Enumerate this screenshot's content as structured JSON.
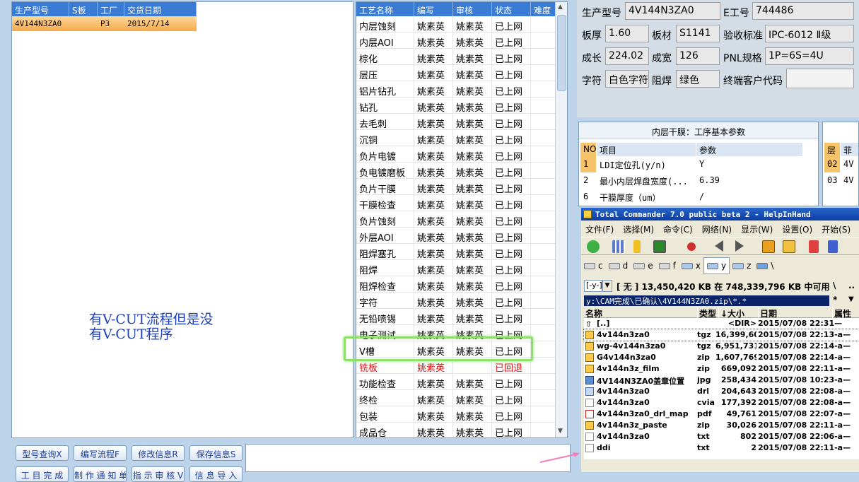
{
  "order_grid": {
    "headers": [
      "生产型号",
      "S板",
      "工厂",
      "交货日期"
    ],
    "row": {
      "model": "4V144N3ZA0",
      "s_board": "",
      "factory": "P3",
      "delivery": "2015/7/14"
    }
  },
  "note": {
    "line1": "有V-CUT流程但是没",
    "line2": "有V-CUT程序"
  },
  "process_table": {
    "headers": [
      "工艺名称",
      "编写",
      "审核",
      "状态",
      "难度"
    ],
    "rows": [
      {
        "name": "内层蚀刻",
        "writer": "姚素英",
        "reviewer": "姚素英",
        "status": "已上网"
      },
      {
        "name": "内层AOI",
        "writer": "姚素英",
        "reviewer": "姚素英",
        "status": "已上网"
      },
      {
        "name": "棕化",
        "writer": "姚素英",
        "reviewer": "姚素英",
        "status": "已上网"
      },
      {
        "name": "层压",
        "writer": "姚素英",
        "reviewer": "姚素英",
        "status": "已上网"
      },
      {
        "name": "铝片钻孔",
        "writer": "姚素英",
        "reviewer": "姚素英",
        "status": "已上网"
      },
      {
        "name": "钻孔",
        "writer": "姚素英",
        "reviewer": "姚素英",
        "status": "已上网"
      },
      {
        "name": "去毛刺",
        "writer": "姚素英",
        "reviewer": "姚素英",
        "status": "已上网"
      },
      {
        "name": "沉铜",
        "writer": "姚素英",
        "reviewer": "姚素英",
        "status": "已上网"
      },
      {
        "name": "负片电镀",
        "writer": "姚素英",
        "reviewer": "姚素英",
        "status": "已上网"
      },
      {
        "name": "负电镀磨板",
        "writer": "姚素英",
        "reviewer": "姚素英",
        "status": "已上网"
      },
      {
        "name": "负片干膜",
        "writer": "姚素英",
        "reviewer": "姚素英",
        "status": "已上网"
      },
      {
        "name": "干膜检查",
        "writer": "姚素英",
        "reviewer": "姚素英",
        "status": "已上网"
      },
      {
        "name": "负片蚀刻",
        "writer": "姚素英",
        "reviewer": "姚素英",
        "status": "已上网"
      },
      {
        "name": "外层AOI",
        "writer": "姚素英",
        "reviewer": "姚素英",
        "status": "已上网"
      },
      {
        "name": "阻焊塞孔",
        "writer": "姚素英",
        "reviewer": "姚素英",
        "status": "已上网"
      },
      {
        "name": "阻焊",
        "writer": "姚素英",
        "reviewer": "姚素英",
        "status": "已上网"
      },
      {
        "name": "阻焊检查",
        "writer": "姚素英",
        "reviewer": "姚素英",
        "status": "已上网"
      },
      {
        "name": "字符",
        "writer": "姚素英",
        "reviewer": "姚素英",
        "status": "已上网"
      },
      {
        "name": "无铅喷锡",
        "writer": "姚素英",
        "reviewer": "姚素英",
        "status": "已上网"
      },
      {
        "name": "电子测试",
        "writer": "姚素英",
        "reviewer": "姚素英",
        "status": "已上网"
      },
      {
        "name": "V槽",
        "writer": "姚素英",
        "reviewer": "姚素英",
        "status": "已上网"
      },
      {
        "name": "铣板",
        "writer": "姚素英",
        "reviewer": "",
        "status": "已回退",
        "red": true
      },
      {
        "name": "功能检查",
        "writer": "姚素英",
        "reviewer": "姚素英",
        "status": "已上网"
      },
      {
        "name": "终检",
        "writer": "姚素英",
        "reviewer": "姚素英",
        "status": "已上网"
      },
      {
        "name": "包装",
        "writer": "姚素英",
        "reviewer": "姚素英",
        "status": "已上网"
      },
      {
        "name": "成品仓",
        "writer": "姚素英",
        "reviewer": "姚素英",
        "status": "已上网"
      }
    ]
  },
  "info": {
    "model_label": "生产型号",
    "model": "4V144N3ZA0",
    "eno_label": "E工号",
    "eno": "744486",
    "thickness_label": "板厚",
    "thickness": "1.60",
    "material_label": "板材",
    "material": "S1141",
    "standard_label": "验收标准",
    "standard": "IPC-6012 Ⅱ级",
    "length_label": "成长",
    "length": "224.02",
    "width_label": "成宽",
    "width": "126",
    "pnl_label": "PNL规格",
    "pnl": "1P=6S=4U",
    "char_label": "字符",
    "char": "白色字符",
    "mask_label": "阻焊",
    "mask": "绿色",
    "customer_label": "终端客户代码",
    "customer": ""
  },
  "film": {
    "title": "内层干膜：工序基本参数",
    "headers": {
      "no": "NO",
      "item": "项目",
      "param": "参数"
    },
    "rows": [
      {
        "no": "1",
        "item": "LDI定位孔(y/n)",
        "param": "Y"
      },
      {
        "no": "2",
        "item": "最小内层焊盘宽度(...",
        "param": "6.39"
      },
      {
        "no": "6",
        "item": "干膜厚度（um）",
        "param": "/"
      }
    ]
  },
  "layers": {
    "headers": [
      "层",
      "菲"
    ],
    "rows": [
      {
        "layer": "02",
        "val": "4V"
      },
      {
        "layer": "03",
        "val": "4V"
      }
    ]
  },
  "tc": {
    "title": "Total Commander 7.0 public beta 2 - HelpInHand",
    "menu": [
      "文件(F)",
      "选择(M)",
      "命令(C)",
      "网络(N)",
      "显示(W)",
      "设置(O)",
      "开始(S)"
    ],
    "drives": [
      "c",
      "d",
      "e",
      "f",
      "x",
      "y",
      "z",
      "\\"
    ],
    "drive_select": "[-y-]",
    "free_space": "[ 无 ]  13,450,420 KB 在 748,339,796 KB 中可用",
    "path_extra": "\\",
    "path_extra2": "..",
    "path": "y:\\CAM完成\\已确认\\4V144N3ZA0.zip\\*.*",
    "filter_star": "*",
    "file_headers": {
      "name": "名称",
      "type": "类型",
      "size": "↓大小",
      "date": "日期",
      "attr": "属性"
    },
    "files": [
      {
        "name": "[..]",
        "type": "",
        "size": "<DIR>",
        "date": "2015/07/08 22:31—",
        "icon": "up"
      },
      {
        "name": "4v144n3za0",
        "type": "tgz",
        "size": "16,399,603",
        "date": "2015/07/08 22:13-a—",
        "icon": "zip",
        "cur": true
      },
      {
        "name": "wg-4v144n3za0",
        "type": "tgz",
        "size": "6,951,731",
        "date": "2015/07/08 22:14-a—",
        "icon": "zip"
      },
      {
        "name": "G4v144n3za0",
        "type": "zip",
        "size": "1,607,769",
        "date": "2015/07/08 22:14-a—",
        "icon": "zip"
      },
      {
        "name": "4v144n3z_film",
        "type": "zip",
        "size": "669,092",
        "date": "2015/07/08 22:11-a—",
        "icon": "zip"
      },
      {
        "name": "4V144N3ZA0盖章位置",
        "type": "jpg",
        "size": "258,434",
        "date": "2015/07/08 10:23-a—",
        "icon": "img"
      },
      {
        "name": "4v144n3za0",
        "type": "drl",
        "size": "204,643",
        "date": "2015/07/08 22:08-a—",
        "icon": "prg"
      },
      {
        "name": "4v144n3za0",
        "type": "cvia",
        "size": "177,392",
        "date": "2015/07/08 22:08-a—",
        "icon": "doc"
      },
      {
        "name": "4v144n3za0_drl_map",
        "type": "pdf",
        "size": "49,761",
        "date": "2015/07/08 22:07-a—",
        "icon": "pdf"
      },
      {
        "name": "4v144n3z_paste",
        "type": "zip",
        "size": "30,026",
        "date": "2015/07/08 22:11-a—",
        "icon": "zip"
      },
      {
        "name": "4v144n3za0",
        "type": "txt",
        "size": "802",
        "date": "2015/07/08 22:06-a—",
        "icon": "doc"
      },
      {
        "name": "ddi",
        "type": "txt",
        "size": "2",
        "date": "2015/07/08 22:11-a—",
        "icon": "doc"
      }
    ]
  },
  "buttons": {
    "row1": [
      "型号查询X",
      "编写流程F",
      "修改信息R",
      "保存信息S"
    ],
    "row2": [
      "工 目 完 成",
      "制 作 通 知 单",
      "指 示 审 核 V",
      "信 息 导 入"
    ]
  },
  "colors": {
    "accent": "#3a7bd5",
    "selected_row": "#f5a94a",
    "highlight": "#8ee06a",
    "status_red": "#e01010",
    "note_text": "#1c3fbf"
  }
}
